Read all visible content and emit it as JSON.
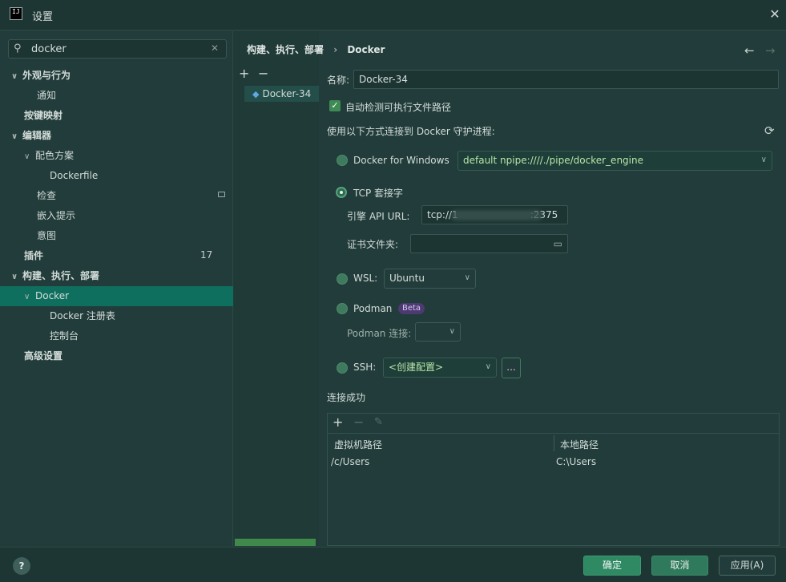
{
  "window": {
    "title": "设置",
    "app_icon_text": "IJ"
  },
  "search": {
    "value": "docker"
  },
  "sidebar": {
    "items": [
      {
        "label": "外观与行为"
      },
      {
        "label": "通知"
      },
      {
        "label": "按键映射"
      },
      {
        "label": "编辑器"
      },
      {
        "label": "配色方案"
      },
      {
        "label": "Dockerfile"
      },
      {
        "label": "检查"
      },
      {
        "label": "嵌入提示"
      },
      {
        "label": "意图"
      },
      {
        "label": "插件",
        "count": "17"
      },
      {
        "label": "构建、执行、部署"
      },
      {
        "label": "Docker"
      },
      {
        "label": "Docker 注册表"
      },
      {
        "label": "控制台"
      },
      {
        "label": "高级设置"
      }
    ]
  },
  "breadcrumb": {
    "parent": "构建、执行、部署",
    "separator": "›",
    "current": "Docker"
  },
  "midcol": {
    "add": "+",
    "remove": "−",
    "items": [
      {
        "label": "Docker-34"
      }
    ]
  },
  "form": {
    "name_label": "名称:",
    "name_value": "Docker-34",
    "auto_detect_label": "自动检测可执行文件路径",
    "connect_heading": "使用以下方式连接到 Docker 守护进程:",
    "docker_windows_label": "Docker for Windows",
    "docker_windows_value": "default  npipe:////./pipe/docker_engine",
    "tcp_label": "TCP 套接字",
    "engine_api_label": "引擎 API URL:",
    "engine_api_value_prefix": "tcp://1",
    "engine_api_value_suffix": ":2375",
    "cert_folder_label": "证书文件夹:",
    "wsl_label": "WSL:",
    "wsl_value": "Ubuntu",
    "podman_label": "Podman",
    "beta_label": "Beta",
    "podman_conn_label": "Podman 连接:",
    "ssh_label": "SSH:",
    "ssh_value": "<创建配置>",
    "ssh_more": "...",
    "status": "连接成功"
  },
  "table": {
    "columns": [
      "虚拟机路径",
      "本地路径"
    ],
    "rows": [
      [
        "/c/Users",
        "C:\\Users"
      ]
    ]
  },
  "footer": {
    "help": "?",
    "ok": "确定",
    "cancel": "取消",
    "apply": "应用(A)"
  },
  "colors": {
    "accent": "#0f6f5e",
    "ok_button": "#2f8a64",
    "background": "#213c3a"
  }
}
